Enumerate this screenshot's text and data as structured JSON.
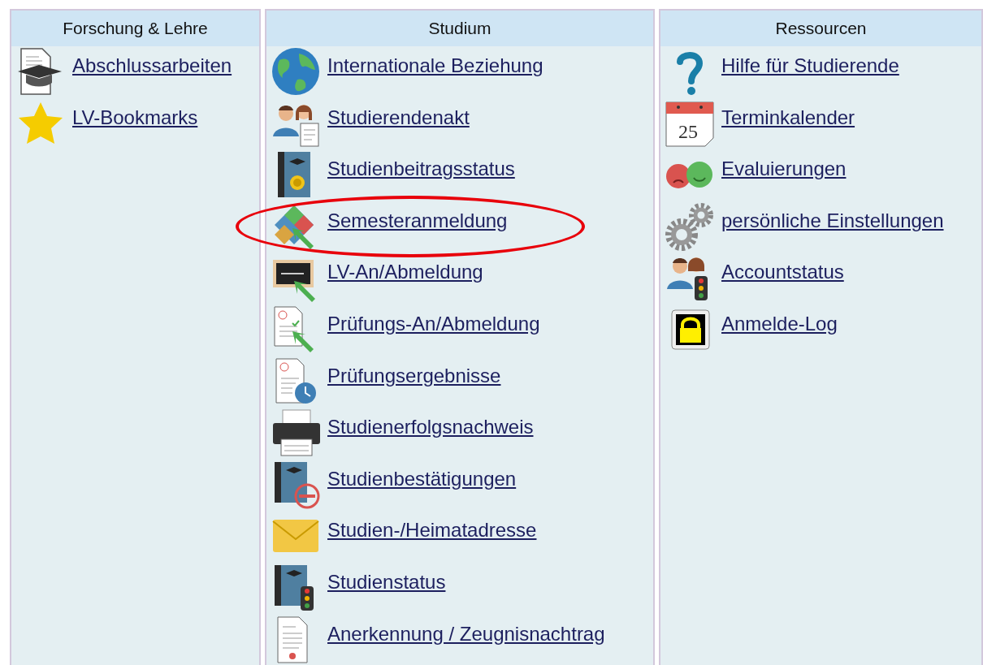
{
  "columns": [
    {
      "title": "Forschung & Lehre",
      "items": [
        {
          "label": "Abschlussarbeiten",
          "kind": "thesis",
          "highlighted": false
        },
        {
          "label": "LV-Bookmarks",
          "kind": "star",
          "highlighted": false
        }
      ]
    },
    {
      "title": "Studium",
      "items": [
        {
          "label": "Internationale Beziehung",
          "kind": "globe",
          "highlighted": false
        },
        {
          "label": "Studierendenakt",
          "kind": "people-doc",
          "highlighted": false
        },
        {
          "label": "Studienbeitragsstatus",
          "kind": "book-coin",
          "highlighted": false
        },
        {
          "label": "Semesteranmeldung",
          "kind": "puzzle",
          "highlighted": true
        },
        {
          "label": "LV-An/Abmeldung",
          "kind": "board",
          "highlighted": false
        },
        {
          "label": "Prüfungs-An/Abmeldung",
          "kind": "doc-arrow",
          "highlighted": false
        },
        {
          "label": "Prüfungsergebnisse",
          "kind": "doc-clock",
          "highlighted": false
        },
        {
          "label": "Studienerfolgsnachweis",
          "kind": "printer",
          "highlighted": false
        },
        {
          "label": "Studienbestätigungen",
          "kind": "book-stamp",
          "highlighted": false
        },
        {
          "label": "Studien-/Heimatadresse",
          "kind": "envelope",
          "highlighted": false
        },
        {
          "label": "Studienstatus",
          "kind": "book-light",
          "highlighted": false
        },
        {
          "label": "Anerkennung / Zeugnisnachtrag",
          "kind": "certificate",
          "highlighted": false
        }
      ]
    },
    {
      "title": "Ressourcen",
      "items": [
        {
          "label": "Hilfe für Studierende",
          "kind": "question",
          "highlighted": false
        },
        {
          "label": "Terminkalender",
          "kind": "calendar",
          "icon_text": "25",
          "highlighted": false
        },
        {
          "label": "Evaluierungen",
          "kind": "faces",
          "highlighted": false
        },
        {
          "label": "persönliche Einstellungen",
          "kind": "gears",
          "highlighted": false
        },
        {
          "label": "Accountstatus",
          "kind": "people-light",
          "highlighted": false
        },
        {
          "label": "Anmelde-Log",
          "kind": "padlock",
          "highlighted": false
        }
      ]
    }
  ]
}
